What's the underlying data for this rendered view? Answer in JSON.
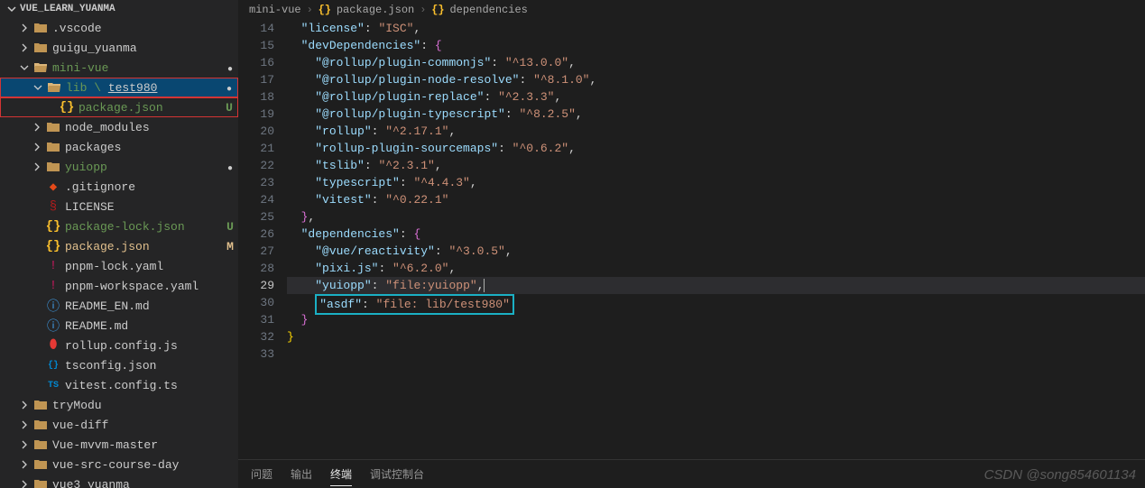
{
  "sidebar": {
    "title": "VUE_LEARN_YUANMA",
    "items": [
      {
        "indent": 1,
        "chev": "right",
        "icon": "folder",
        "label": ".vscode",
        "status": "",
        "cls": ""
      },
      {
        "indent": 1,
        "chev": "right",
        "icon": "folder",
        "label": "guigu_yuanma",
        "status": "",
        "cls": ""
      },
      {
        "indent": 1,
        "chev": "down",
        "icon": "folder-open",
        "label": "mini-vue",
        "status": "dot",
        "cls": "green-text"
      },
      {
        "indent": 2,
        "chev": "down",
        "icon": "folder-open",
        "label_html": "lib \\ <span class='underline-part'>test980</span>",
        "status": "dot",
        "cls": "green-text selected red-box"
      },
      {
        "indent": 3,
        "chev": "",
        "icon": "json",
        "label": "package.json",
        "status": "U",
        "cls": "green-text red-box"
      },
      {
        "indent": 2,
        "chev": "right",
        "icon": "folder",
        "label": "node_modules",
        "status": "",
        "cls": ""
      },
      {
        "indent": 2,
        "chev": "right",
        "icon": "folder",
        "label": "packages",
        "status": "",
        "cls": ""
      },
      {
        "indent": 2,
        "chev": "right",
        "icon": "folder",
        "label": "yuiopp",
        "status": "dot",
        "cls": "green-text"
      },
      {
        "indent": 2,
        "chev": "",
        "icon": "git",
        "label": ".gitignore",
        "status": "",
        "cls": ""
      },
      {
        "indent": 2,
        "chev": "",
        "icon": "license",
        "label": "LICENSE",
        "status": "",
        "cls": ""
      },
      {
        "indent": 2,
        "chev": "",
        "icon": "json",
        "label": "package-lock.json",
        "status": "U",
        "cls": "green-text"
      },
      {
        "indent": 2,
        "chev": "",
        "icon": "json",
        "label": "package.json",
        "status": "M",
        "cls": "yellow-text"
      },
      {
        "indent": 2,
        "chev": "",
        "icon": "yaml",
        "label": "pnpm-lock.yaml",
        "status": "",
        "cls": ""
      },
      {
        "indent": 2,
        "chev": "",
        "icon": "yaml",
        "label": "pnpm-workspace.yaml",
        "status": "",
        "cls": ""
      },
      {
        "indent": 2,
        "chev": "",
        "icon": "md",
        "label": "README_EN.md",
        "status": "",
        "cls": ""
      },
      {
        "indent": 2,
        "chev": "",
        "icon": "md",
        "label": "README.md",
        "status": "",
        "cls": ""
      },
      {
        "indent": 2,
        "chev": "",
        "icon": "js",
        "label": "rollup.config.js",
        "status": "",
        "cls": ""
      },
      {
        "indent": 2,
        "chev": "",
        "icon": "ts-json",
        "label": "tsconfig.json",
        "status": "",
        "cls": ""
      },
      {
        "indent": 2,
        "chev": "",
        "icon": "ts",
        "label": "vitest.config.ts",
        "status": "",
        "cls": ""
      },
      {
        "indent": 1,
        "chev": "right",
        "icon": "folder",
        "label": "tryModu",
        "status": "",
        "cls": ""
      },
      {
        "indent": 1,
        "chev": "right",
        "icon": "folder",
        "label": "vue-diff",
        "status": "",
        "cls": ""
      },
      {
        "indent": 1,
        "chev": "right",
        "icon": "folder",
        "label": "Vue-mvvm-master",
        "status": "",
        "cls": ""
      },
      {
        "indent": 1,
        "chev": "right",
        "icon": "folder",
        "label": "vue-src-course-day",
        "status": "",
        "cls": ""
      },
      {
        "indent": 1,
        "chev": "right",
        "icon": "folder",
        "label": "vue3_yuanma",
        "status": "",
        "cls": ""
      }
    ]
  },
  "breadcrumb": {
    "parts": [
      "mini-vue",
      "package.json",
      "dependencies"
    ],
    "icons": [
      "",
      "json",
      "json"
    ]
  },
  "code": {
    "startLine": 14,
    "lines": [
      {
        "n": 14,
        "html": "  <span class='tok-key'>\"license\"</span><span class='tok-pun'>: </span><span class='tok-str'>\"ISC\"</span><span class='tok-pun'>,</span>"
      },
      {
        "n": 15,
        "html": "  <span class='tok-key'>\"devDependencies\"</span><span class='tok-pun'>: </span><span class='tok-brace2'>{</span>"
      },
      {
        "n": 16,
        "html": "    <span class='tok-key'>\"@rollup/plugin-commonjs\"</span><span class='tok-pun'>: </span><span class='tok-str'>\"^13.0.0\"</span><span class='tok-pun'>,</span>"
      },
      {
        "n": 17,
        "html": "    <span class='tok-key'>\"@rollup/plugin-node-resolve\"</span><span class='tok-pun'>: </span><span class='tok-str'>\"^8.1.0\"</span><span class='tok-pun'>,</span>"
      },
      {
        "n": 18,
        "html": "    <span class='tok-key'>\"@rollup/plugin-replace\"</span><span class='tok-pun'>: </span><span class='tok-str'>\"^2.3.3\"</span><span class='tok-pun'>,</span>"
      },
      {
        "n": 19,
        "html": "    <span class='tok-key'>\"@rollup/plugin-typescript\"</span><span class='tok-pun'>: </span><span class='tok-str'>\"^8.2.5\"</span><span class='tok-pun'>,</span>"
      },
      {
        "n": 20,
        "html": "    <span class='tok-key'>\"rollup\"</span><span class='tok-pun'>: </span><span class='tok-str'>\"^2.17.1\"</span><span class='tok-pun'>,</span>"
      },
      {
        "n": 21,
        "html": "    <span class='tok-key'>\"rollup-plugin-sourcemaps\"</span><span class='tok-pun'>: </span><span class='tok-str'>\"^0.6.2\"</span><span class='tok-pun'>,</span>"
      },
      {
        "n": 22,
        "html": "    <span class='tok-key'>\"tslib\"</span><span class='tok-pun'>: </span><span class='tok-str'>\"^2.3.1\"</span><span class='tok-pun'>,</span>"
      },
      {
        "n": 23,
        "html": "    <span class='tok-key'>\"typescript\"</span><span class='tok-pun'>: </span><span class='tok-str'>\"^4.4.3\"</span><span class='tok-pun'>,</span>"
      },
      {
        "n": 24,
        "html": "    <span class='tok-key'>\"vitest\"</span><span class='tok-pun'>: </span><span class='tok-str'>\"^0.22.1\"</span>"
      },
      {
        "n": 25,
        "html": "  <span class='tok-brace2'>}</span><span class='tok-pun'>,</span>"
      },
      {
        "n": 26,
        "html": "  <span class='tok-key'>\"dependencies\"</span><span class='tok-pun'>: </span><span class='tok-brace2'>{</span>"
      },
      {
        "n": 27,
        "html": "    <span class='tok-key'>\"@vue/reactivity\"</span><span class='tok-pun'>: </span><span class='tok-str'>\"^3.0.5\"</span><span class='tok-pun'>,</span>"
      },
      {
        "n": 28,
        "html": "    <span class='tok-key'>\"pixi.js\"</span><span class='tok-pun'>: </span><span class='tok-str'>\"^6.2.0\"</span><span class='tok-pun'>,</span>"
      },
      {
        "n": 29,
        "html": "    <span class='tok-key'>\"yuiopp\"</span><span class='tok-pun'>: </span><span class='tok-str'>\"file:yuiopp\"</span><span class='tok-pun'>,</span><span class='cursor'></span>",
        "current": true
      },
      {
        "n": 30,
        "html": "    <span class='highlight-box'><span class='tok-key'>\"asdf\"</span><span class='tok-pun'>: </span><span class='tok-str'>\"file: lib/test980\"</span></span>"
      },
      {
        "n": 31,
        "html": "  <span class='tok-brace2'>}</span>"
      },
      {
        "n": 32,
        "html": "<span class='tok-brace'>}</span>"
      },
      {
        "n": 33,
        "html": ""
      }
    ]
  },
  "terminal": {
    "tabs": [
      "问题",
      "输出",
      "终端",
      "调试控制台"
    ],
    "active": 2
  },
  "watermark": "CSDN @song854601134"
}
